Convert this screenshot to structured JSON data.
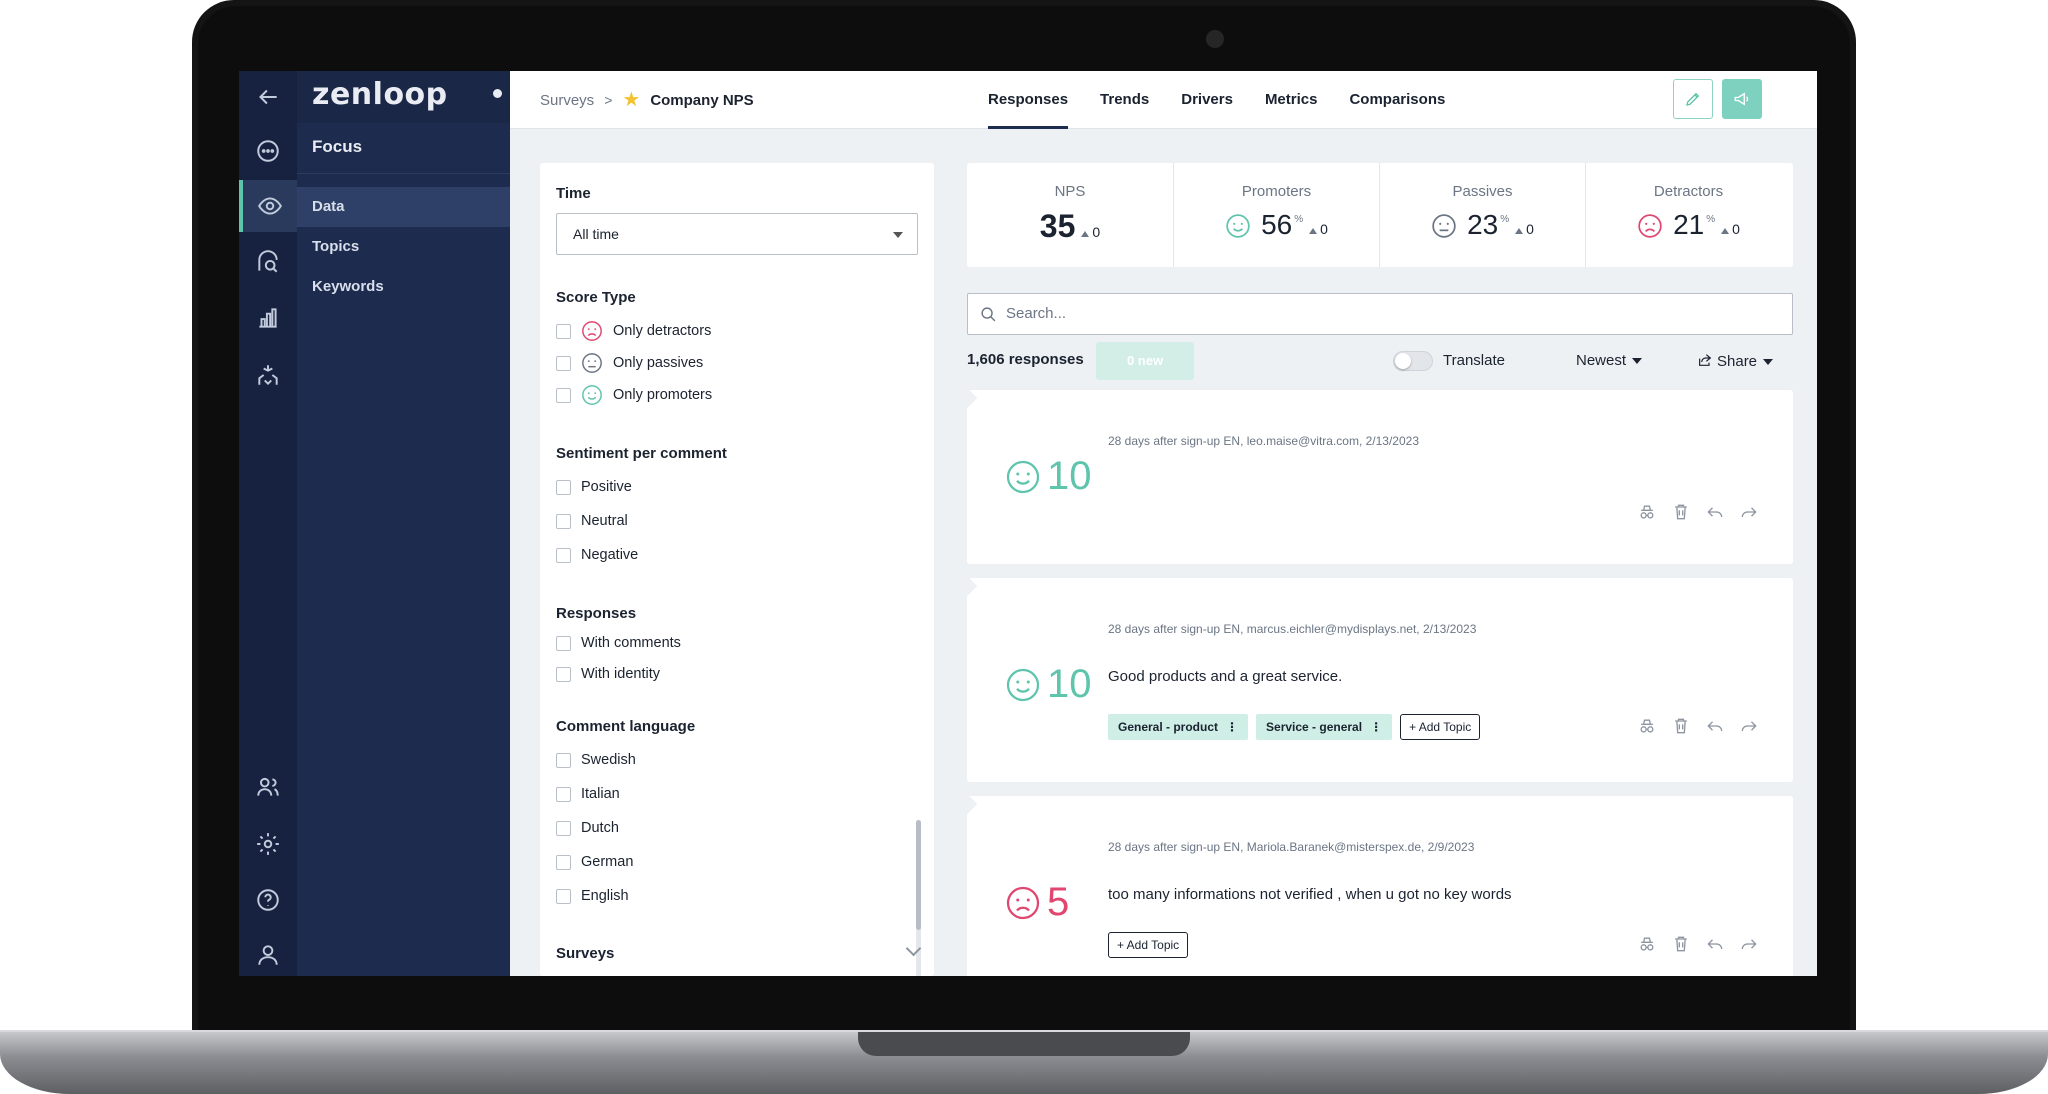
{
  "app": {
    "brand": "zenloop"
  },
  "subnav": {
    "title": "Focus",
    "items": [
      "Data",
      "Topics",
      "Keywords"
    ]
  },
  "breadcrumb": {
    "root": "Surveys",
    "current": "Company NPS"
  },
  "tabs": [
    "Responses",
    "Trends",
    "Drivers",
    "Metrics",
    "Comparisons"
  ],
  "filters": {
    "time_label": "Time",
    "time_value": "All time",
    "score_type_label": "Score Type",
    "score_types": [
      "Only detractors",
      "Only passives",
      "Only promoters"
    ],
    "sentiment_label": "Sentiment per comment",
    "sentiments": [
      "Positive",
      "Neutral",
      "Negative"
    ],
    "responses_label": "Responses",
    "responses": [
      "With comments",
      "With identity"
    ],
    "language_label": "Comment language",
    "languages": [
      "Swedish",
      "Italian",
      "Dutch",
      "German",
      "English"
    ],
    "surveys_label": "Surveys"
  },
  "metrics": [
    {
      "title": "NPS",
      "value": "35",
      "pct": "",
      "delta": "0"
    },
    {
      "title": "Promoters",
      "value": "56",
      "pct": "%",
      "delta": "0"
    },
    {
      "title": "Passives",
      "value": "23",
      "pct": "%",
      "delta": "0"
    },
    {
      "title": "Detractors",
      "value": "21",
      "pct": "%",
      "delta": "0"
    }
  ],
  "search": {
    "placeholder": "Search..."
  },
  "toolbar": {
    "count": "1,606 responses",
    "new_label": "0 new",
    "translate": "Translate",
    "sort": "Newest",
    "share": "Share"
  },
  "responses": [
    {
      "score": "10",
      "meta": "28 days after sign-up EN, leo.maise@vitra.com, 2/13/2023",
      "comment": "",
      "tags": []
    },
    {
      "score": "10",
      "meta": "28 days after sign-up EN, marcus.eichler@mydisplays.net, 2/13/2023",
      "comment": "Good products and a great service.",
      "tags": [
        "General - product",
        "Service - general"
      ]
    },
    {
      "score": "5",
      "meta": "28 days after sign-up EN, Mariola.Baranek@misterspex.de, 2/9/2023",
      "comment": "too many informations not verified , when u got no key words",
      "tags": []
    }
  ],
  "add_topic_label": "+ Add Topic",
  "colors": {
    "promoter": "#5ec4ac",
    "passive": "#6b7584",
    "detractor": "#e0466f",
    "sidebar": "#1d2c4e",
    "accent": "#7ed1bf"
  }
}
